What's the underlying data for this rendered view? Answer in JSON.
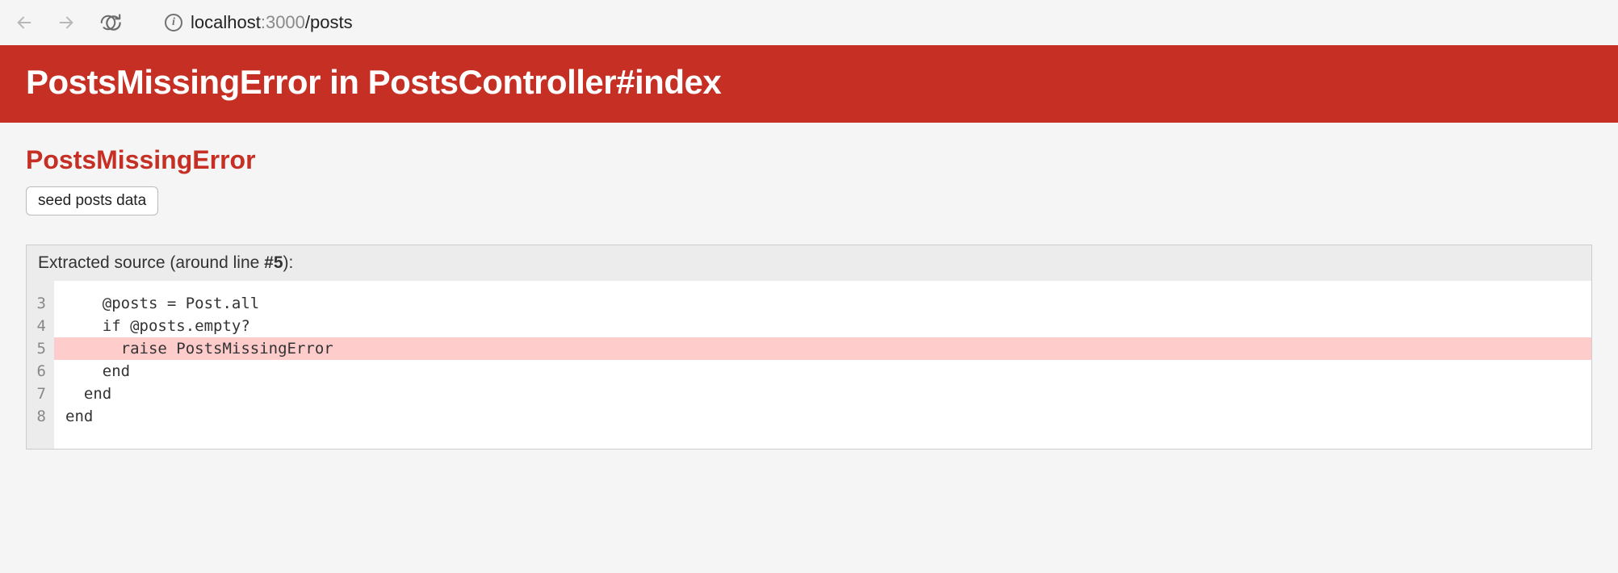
{
  "browser": {
    "url_host": "localhost",
    "url_port": ":3000",
    "url_path": "/posts"
  },
  "error": {
    "title": "PostsMissingError in PostsController#index",
    "exception_name": "PostsMissingError",
    "action_button_label": "seed posts data"
  },
  "source": {
    "header_prefix": "Extracted source (around line ",
    "header_line": "#5",
    "header_suffix": "):",
    "highlight_index": 2,
    "lines": [
      {
        "num": "3",
        "code": "    @posts = Post.all"
      },
      {
        "num": "4",
        "code": "    if @posts.empty?"
      },
      {
        "num": "5",
        "code": "      raise PostsMissingError"
      },
      {
        "num": "6",
        "code": "    end"
      },
      {
        "num": "7",
        "code": "  end"
      },
      {
        "num": "8",
        "code": "end"
      }
    ]
  }
}
